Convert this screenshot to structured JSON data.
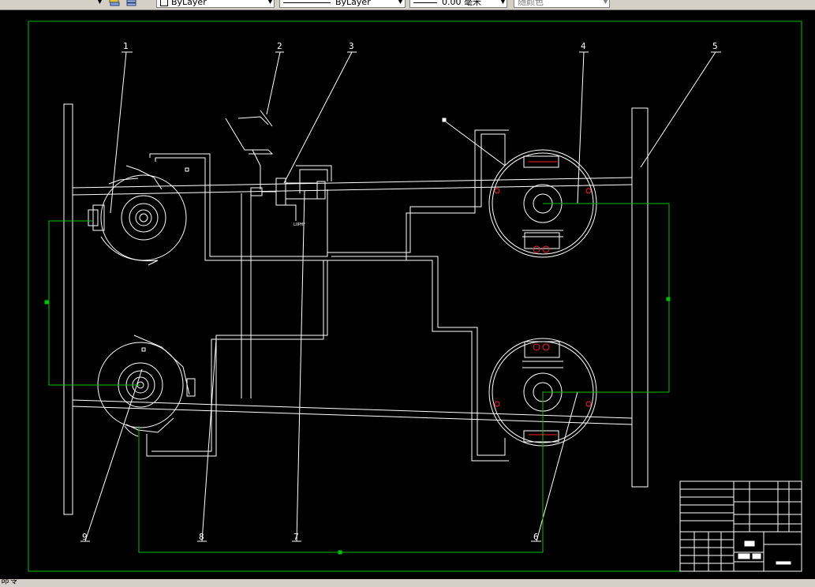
{
  "app": {
    "toolbar": {
      "color_dropdown": "ByLayer",
      "linetype_dropdown": "ByLayer",
      "lineweight_value": "0.00 毫米",
      "plotstyle_dropdown": "随颜色"
    },
    "status": {
      "command_prompt": "命令"
    }
  },
  "drawing": {
    "callouts": [
      "1",
      "2",
      "3",
      "4",
      "5",
      "6",
      "7",
      "8",
      "9"
    ],
    "colors": {
      "background": "#000000",
      "frame": "#00c000",
      "lines": "#ffffff",
      "highlight": "#ff2020"
    }
  }
}
